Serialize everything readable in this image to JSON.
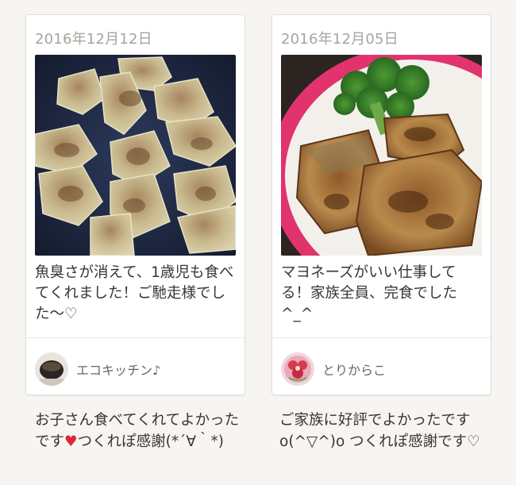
{
  "cards": [
    {
      "date": "2016年12月12日",
      "photo_icon": "fried-fish-nuggets-photo",
      "comment": "魚臭さが消えて、1歳児も食べてくれました！ご馳走様でした〜♡",
      "author": "エコキッチン♪",
      "avatar_icon": "coffee-cup-avatar",
      "reply_before": "お子さん食べてくれてよかったです",
      "reply_heart": "♥",
      "reply_after": "つくれぽ感謝(*´∀｀*)"
    },
    {
      "date": "2016年12月05日",
      "photo_icon": "mayo-fried-fish-with-broccoli-photo",
      "comment": "マヨネーズがいい仕事してる！家族全員、完食でした^_^",
      "author": "とりからこ",
      "avatar_icon": "pink-flower-avatar",
      "reply_before": "ご家族に好評でよかったですo(^▽^)o つくれぽ感謝です♡",
      "reply_heart": "",
      "reply_after": ""
    }
  ],
  "colors": {
    "heart": "#e0243a",
    "date_text": "#a8a39d",
    "body_text": "#3b3530"
  }
}
